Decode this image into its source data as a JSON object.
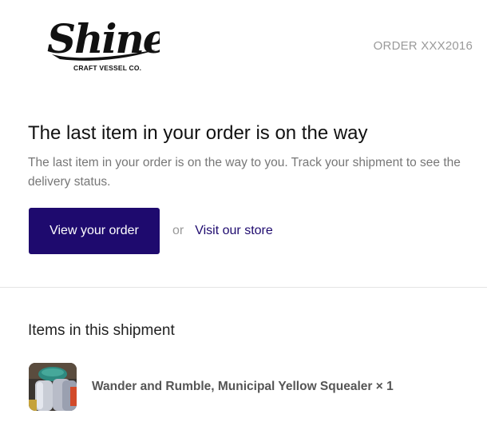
{
  "header": {
    "logo_text": "Shine",
    "logo_tagline": "CRAFT VESSEL CO.",
    "order_number": "ORDER XXX2016"
  },
  "message": {
    "headline": "The last item in your order is on the way",
    "body": "The last item in your order is on the way to you. Track your shipment to see the delivery status."
  },
  "actions": {
    "primary_label": "View your order",
    "or_label": "or",
    "secondary_label": "Visit our store"
  },
  "shipment": {
    "title": "Items in this shipment",
    "items": [
      {
        "name": "Wander and Rumble, Municipal Yellow Squealer × 1",
        "thumbnail_icon": "product-photo"
      }
    ]
  },
  "colors": {
    "brand": "#1e0a6e",
    "muted_text": "#777777",
    "order_number": "#9a9a9a",
    "divider": "#e5e5e5"
  }
}
